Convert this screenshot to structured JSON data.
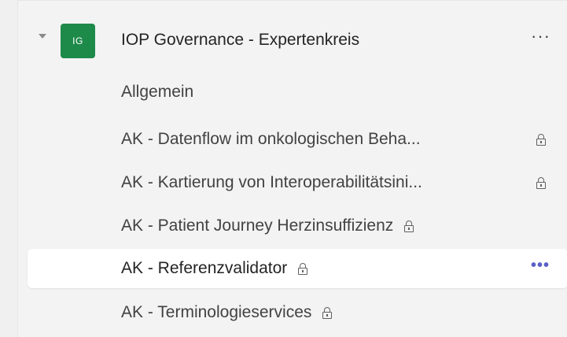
{
  "team": {
    "avatar_initials": "IG",
    "avatar_color": "#1e8a4a",
    "name": "IOP Governance - Expertenkreis",
    "more_label": "···"
  },
  "channels": [
    {
      "label": "Allgemein"
    },
    {
      "label": "AK - Datenflow im onkologischen Beha..."
    },
    {
      "label": "AK - Kartierung von Interoperabilitätsini..."
    },
    {
      "label": "AK - Patient Journey Herzinsuffizienz"
    },
    {
      "label": "AK - Referenzvalidator"
    },
    {
      "label": "AK - Terminologieservices"
    }
  ],
  "selected_channel_more": "•••",
  "accent_color": "#5b5fc7"
}
